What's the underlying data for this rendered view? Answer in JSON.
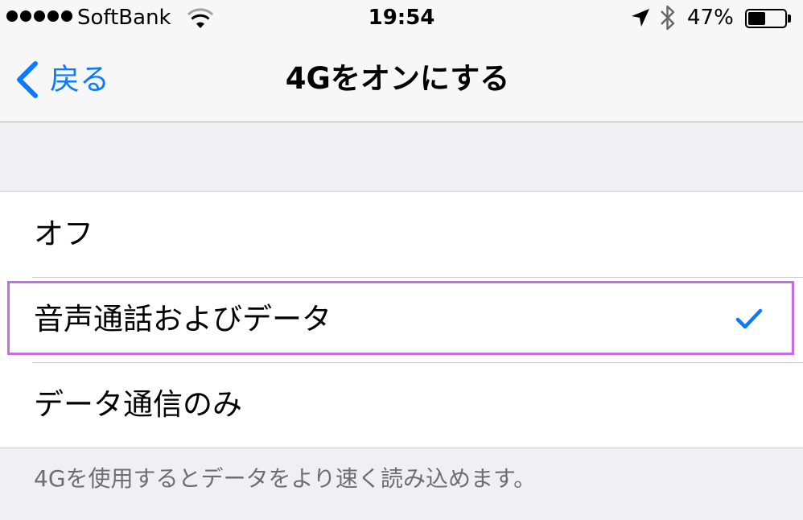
{
  "status_bar": {
    "signal_bars": 5,
    "carrier": "SoftBank",
    "time": "19:54",
    "battery_percent": "47%",
    "battery_level": 0.47
  },
  "nav": {
    "back_label": "戻る",
    "title": "4Gをオンにする"
  },
  "options": [
    {
      "label": "オフ",
      "selected": false
    },
    {
      "label": "音声通話およびデータ",
      "selected": true
    },
    {
      "label": "データ通信のみ",
      "selected": false
    }
  ],
  "footer": {
    "note": "4Gを使用するとデータをより速く読み込めます。"
  },
  "colors": {
    "accent": "#0a7aff",
    "highlight": "#c66ce6"
  },
  "icons": [
    "wifi-icon",
    "location-arrow-icon",
    "bluetooth-icon",
    "battery-icon",
    "chevron-left-icon",
    "checkmark-icon"
  ]
}
